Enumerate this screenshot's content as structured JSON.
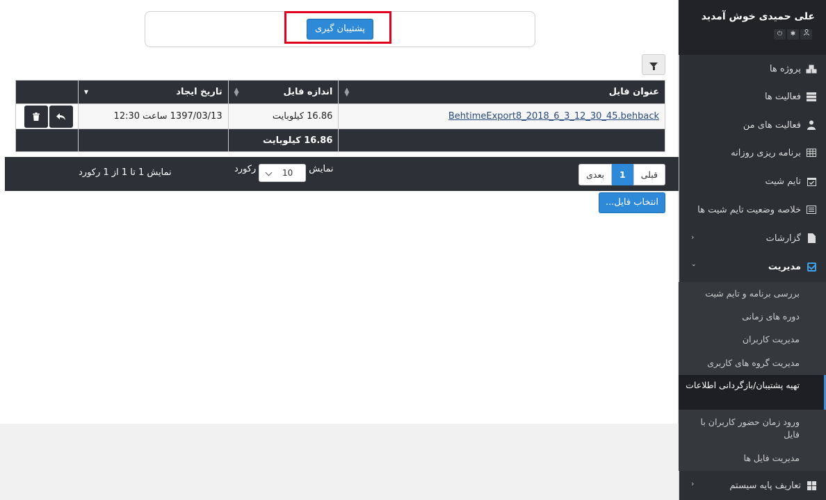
{
  "sidebar": {
    "welcome": "علی حمیدی خوش آمدید",
    "user_icons": [
      "user-icon",
      "gear-icon",
      "power-icon"
    ],
    "items": [
      {
        "label": "پروژه ها",
        "icon": "cubes-icon"
      },
      {
        "label": "فعالیت ها",
        "icon": "server-icon"
      },
      {
        "label": "فعالیت های من",
        "icon": "user-tie-icon"
      },
      {
        "label": "برنامه ریزی روزانه",
        "icon": "table-icon"
      },
      {
        "label": "تایم شیت",
        "icon": "calendar-check-icon"
      },
      {
        "label": "خلاصه وضعیت تایم شیت ها",
        "icon": "list-alt-icon"
      },
      {
        "label": "گزارشات",
        "icon": "file-icon"
      },
      {
        "label": "مدیریت",
        "icon": "check-square-icon"
      },
      {
        "label": "تعاریف پایه سیستم",
        "icon": "th-large-icon"
      }
    ],
    "submenu": [
      "بررسی برنامه و تایم شیت",
      "دوره های زمانی",
      "مدیریت کاربران",
      "مدیریت گروه های کاربری",
      "تهیه پشتیبان/بازگردانی اطلاعات",
      "ورود زمان حضور کاربران با فایل",
      "مدیریت فایل ها"
    ]
  },
  "main": {
    "backup_button": "پشتیبان گیری",
    "table": {
      "columns": [
        "عنوان فایل",
        "اندازه فایل",
        "تاریخ ایجاد"
      ],
      "rows": [
        {
          "title": "BehtimeExport8_2018_6_3_12_30_45.behback",
          "size": "16.86 کیلوبایت",
          "created": "1397/03/13 ساعت 12:30"
        }
      ],
      "footer_total": "16.86 کیلوبایت"
    },
    "pager": {
      "prev": "قبلی",
      "current": "1",
      "next": "بعدی",
      "show_label": "نمایش",
      "page_size": "10",
      "records_label": "رکورد",
      "info": "نمایش 1 تا 1 از 1 رکورد"
    },
    "choose_file": "انتخاب فایل..."
  }
}
